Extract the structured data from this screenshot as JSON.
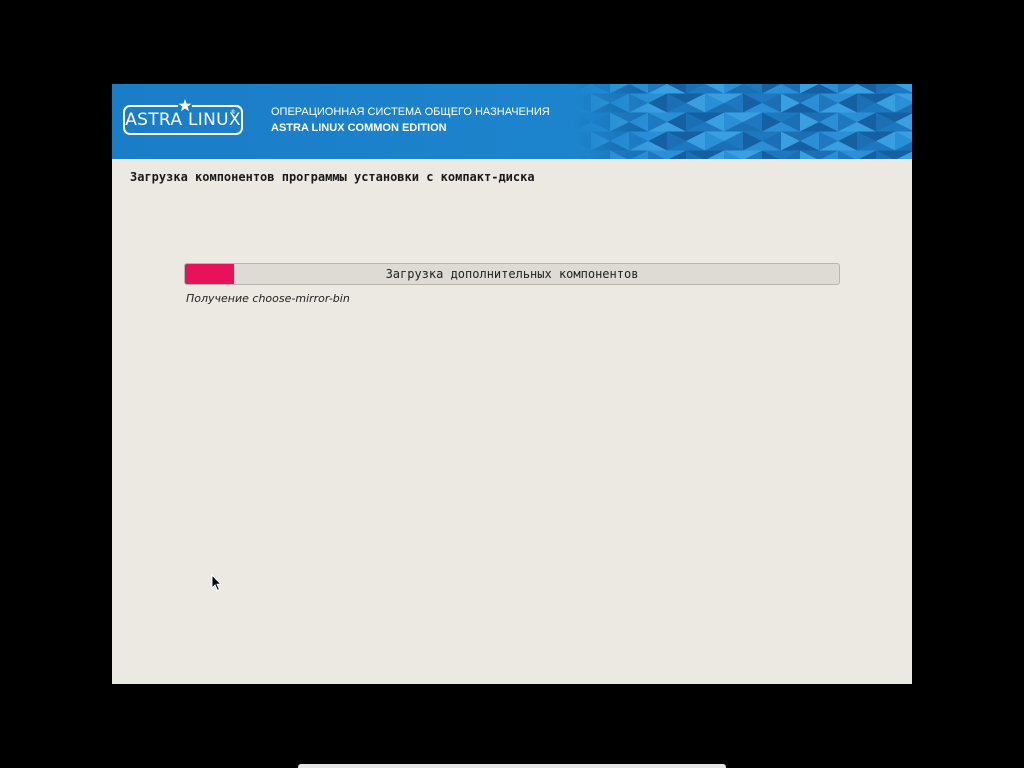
{
  "banner": {
    "logo_text": "ASTRA LINUX",
    "logo_mark": "®",
    "line1": "ОПЕРАЦИОННАЯ СИСТЕМА ОБЩЕГО НАЗНАЧЕНИЯ",
    "line2": "ASTRA LINUX COMMON EDITION",
    "color": "#1a7dc7"
  },
  "heading": "Загрузка компонентов программы установки с компакт-диска",
  "progress": {
    "label": "Загрузка дополнительных компонентов",
    "fraction": 0.075,
    "fill_color": "#e8125a"
  },
  "status_text": "Получение  choose-mirror-bin",
  "icons": {
    "logo_star": "star-icon",
    "pointer": "mouse-pointer-icon"
  }
}
